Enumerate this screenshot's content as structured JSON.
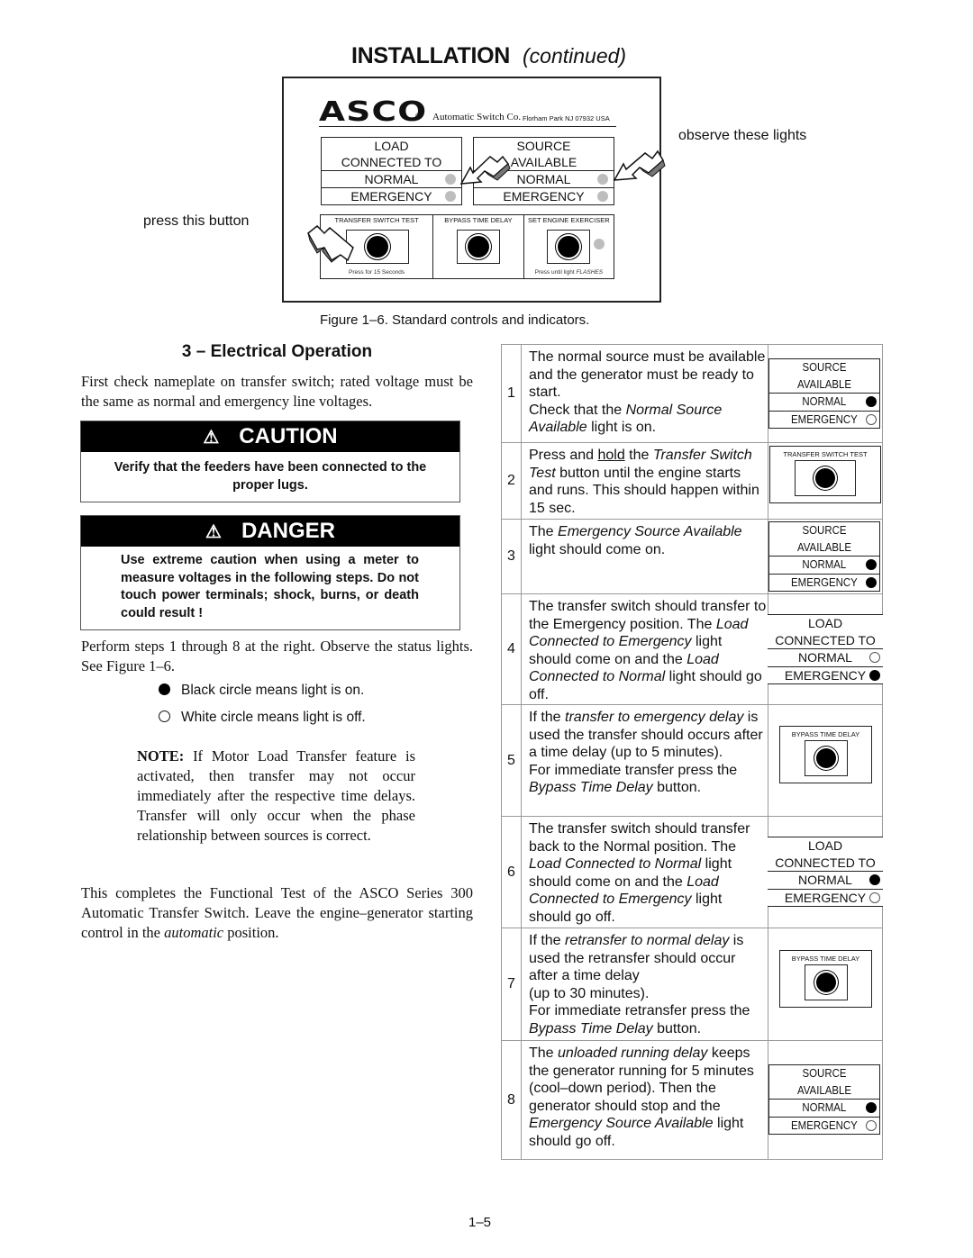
{
  "header": {
    "title": "INSTALLATION",
    "subtitle": "(continued)"
  },
  "figure": {
    "logo": "ASCO",
    "registered_mark": "®",
    "company": "Automatic Switch Co.",
    "address": "Florham Park NJ 07932 USA",
    "load_panel": {
      "title_line1": "LOAD",
      "title_line2": "CONNECTED TO",
      "normal": "NORMAL",
      "emergency": "EMERGENCY"
    },
    "source_panel": {
      "title_line1": "SOURCE",
      "title_line2": "AVAILABLE",
      "normal": "NORMAL",
      "emergency": "EMERGENCY"
    },
    "buttons": [
      {
        "label": "TRANSFER SWITCH TEST",
        "note": "Press for 15 Seconds"
      },
      {
        "label": "BYPASS TIME DELAY",
        "note": ""
      },
      {
        "label": "SET ENGINE EXERCISER",
        "note": "Press until light ",
        "note_italic": "FLASHES"
      }
    ],
    "callout_observe": "observe these lights",
    "callout_press": "press this button",
    "caption": "Figure 1–6.  Standard controls and indicators."
  },
  "section": {
    "title": "3 – Electrical Operation",
    "intro": "First check nameplate on transfer switch; rated voltage must be the same as normal and emergency line voltages.",
    "caution": {
      "heading": "CAUTION",
      "icon": "⚠",
      "body": "Verify that the feeders have been connected to the proper lugs."
    },
    "danger": {
      "heading": "DANGER",
      "icon": "⚠",
      "body": "Use extreme caution when using a meter to measure voltages in the following steps. Do not touch power terminals; shock, burns, or death could result !"
    },
    "perform": "Perform steps 1 through 8 at the right.  Observe the status lights.  See Figure 1–6.",
    "legend": {
      "on": "Black circle means light is on.",
      "off": "White circle means light is off."
    },
    "note_label": "NOTE:",
    "note": " If Motor Load Transfer feature is activated, then transfer may not occur immediately after the respective time delays.  Transfer will only occur when the phase relationship between sources is correct.",
    "complete_1": "This completes the Functional Test of the ASCO Series 300 Automatic Transfer Switch.  Leave the engine–generator starting control in the ",
    "complete_italic": "automatic",
    "complete_2": " position."
  },
  "steps": [
    {
      "num": "1",
      "segments": [
        [
          "The normal source must be available and the generator must be ready to start.",
          ""
        ],
        [
          "\nCheck that the ",
          ""
        ],
        [
          "Normal Source Available",
          "i"
        ],
        [
          " light is on.",
          ""
        ]
      ],
      "indicator": {
        "type": "source",
        "line1": "SOURCE",
        "line2": "AVAILABLE",
        "normal": "NORMAL",
        "emergency": "EMERGENCY",
        "normal_on": true,
        "emergency_on": false
      }
    },
    {
      "num": "2",
      "segments": [
        [
          "Press and ",
          ""
        ],
        [
          "hold",
          "u"
        ],
        [
          " the ",
          ""
        ],
        [
          "Transfer Switch Test",
          "i"
        ],
        [
          " button until the engine starts and runs. This should happen within 15 sec.",
          ""
        ]
      ],
      "indicator": {
        "type": "button",
        "label": "TRANSFER SWITCH TEST"
      }
    },
    {
      "num": "3",
      "segments": [
        [
          "The ",
          ""
        ],
        [
          "Emergency Source Available",
          "i"
        ],
        [
          " light should come on.",
          ""
        ]
      ],
      "indicator": {
        "type": "source",
        "line1": "SOURCE",
        "line2": "AVAILABLE",
        "normal": "NORMAL",
        "emergency": "EMERGENCY",
        "normal_on": true,
        "emergency_on": true
      }
    },
    {
      "num": "4",
      "segments": [
        [
          "The transfer switch should transfer to the Emergency position. The ",
          ""
        ],
        [
          "Load Connected to Emergency",
          "i"
        ],
        [
          " light should come on and the ",
          ""
        ],
        [
          "Load Connected to Normal",
          "i"
        ],
        [
          " light should go off.",
          ""
        ]
      ],
      "indicator": {
        "type": "load",
        "line1": "LOAD",
        "line2": "CONNECTED TO",
        "normal": "NORMAL",
        "emergency": "EMERGENCY",
        "normal_on": false,
        "emergency_on": true
      }
    },
    {
      "num": "5",
      "segments": [
        [
          "If the ",
          ""
        ],
        [
          "transfer to emergency delay",
          "i"
        ],
        [
          " is used the transfer should occurs after a time delay (up to 5 minutes).\nFor immediate transfer press the ",
          ""
        ],
        [
          "Bypass Time Delay",
          "i"
        ],
        [
          " button.",
          ""
        ]
      ],
      "indicator": {
        "type": "button",
        "label": "BYPASS TIME DELAY"
      }
    },
    {
      "num": "6",
      "segments": [
        [
          "The transfer switch should transfer back to the Normal position. The ",
          ""
        ],
        [
          "Load Connected to Normal",
          "i"
        ],
        [
          " light should come on and the ",
          ""
        ],
        [
          "Load Connected to Emergency",
          "i"
        ],
        [
          " light should go off.",
          ""
        ]
      ],
      "indicator": {
        "type": "load",
        "line1": "LOAD",
        "line2": "CONNECTED TO",
        "normal": "NORMAL",
        "emergency": "EMERGENCY",
        "normal_on": true,
        "emergency_on": false
      }
    },
    {
      "num": "7",
      "segments": [
        [
          "If the ",
          ""
        ],
        [
          "retransfer to normal delay",
          "i"
        ],
        [
          " is used the retransfer should occur after a time delay\n(up to 30 minutes).\nFor immediate retransfer press the ",
          ""
        ],
        [
          "Bypass Time Delay",
          "i"
        ],
        [
          " button.",
          ""
        ]
      ],
      "indicator": {
        "type": "button",
        "label": "BYPASS TIME DELAY"
      }
    },
    {
      "num": "8",
      "segments": [
        [
          "The ",
          ""
        ],
        [
          "unloaded running delay",
          "i"
        ],
        [
          " keeps the generator running for 5 minutes (cool–down period). Then the generator should stop and the ",
          ""
        ],
        [
          "Emergency Source Available",
          "i"
        ],
        [
          " light should go off.",
          ""
        ]
      ],
      "indicator": {
        "type": "source",
        "line1": "SOURCE",
        "line2": "AVAILABLE",
        "normal": "NORMAL",
        "emergency": "EMERGENCY",
        "normal_on": true,
        "emergency_on": false
      }
    }
  ],
  "footer": {
    "page_number": "1–5"
  }
}
